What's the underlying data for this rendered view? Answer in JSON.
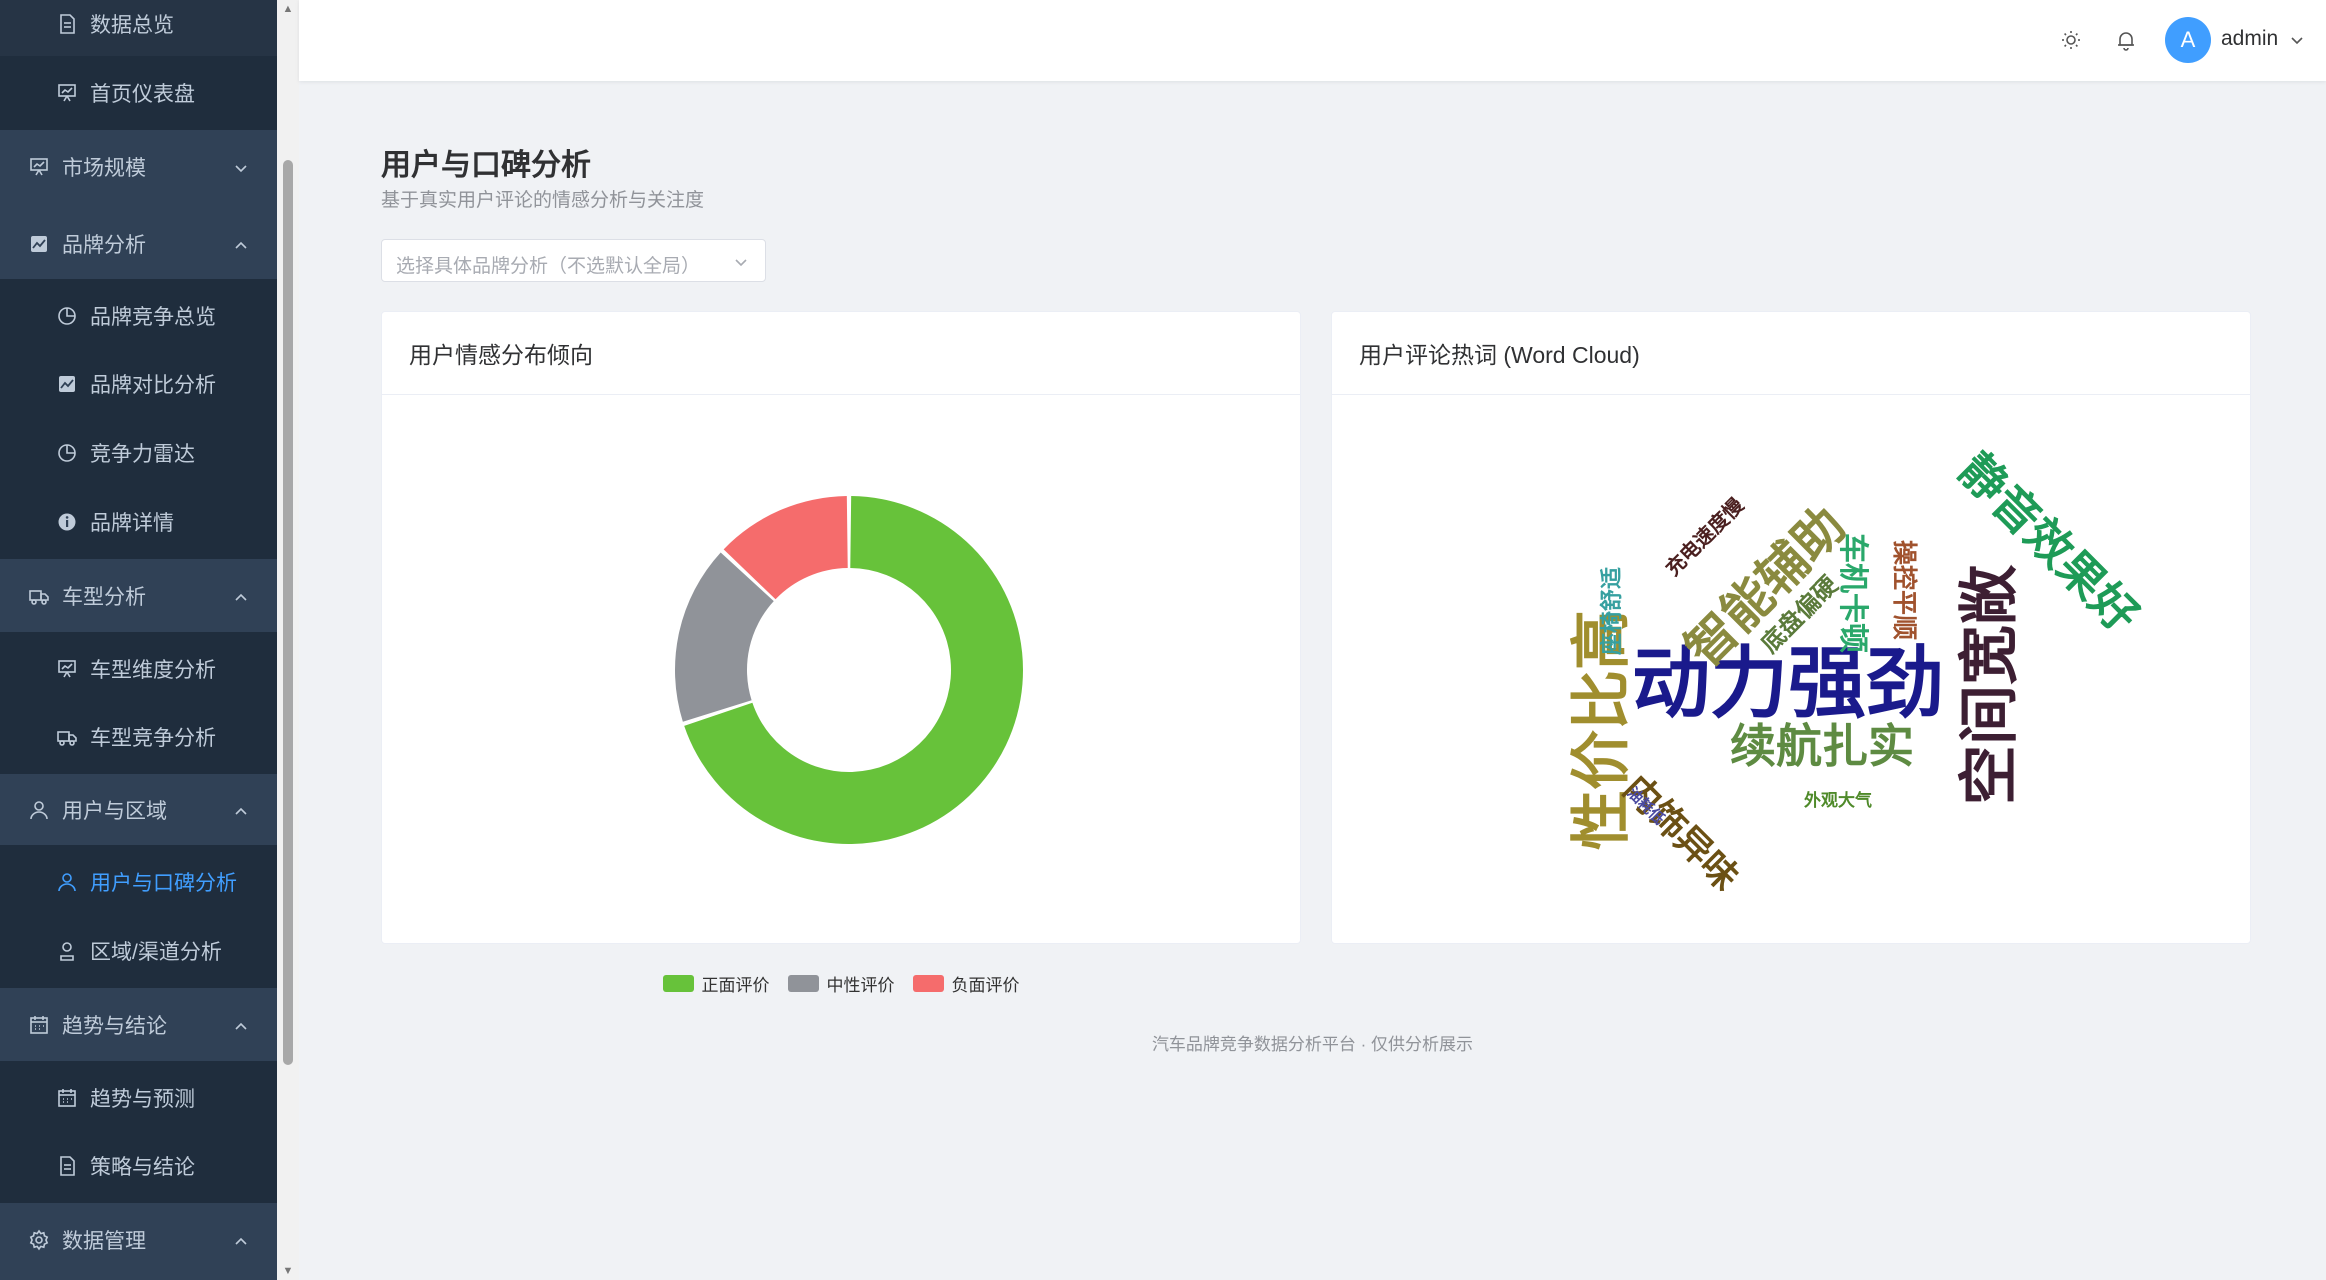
{
  "sidebar": {
    "items": [
      {
        "label": "数据总览",
        "icon": "document-icon",
        "type": "sub"
      },
      {
        "label": "首页仪表盘",
        "icon": "presentation-icon",
        "type": "sub"
      },
      {
        "label": "市场规模",
        "icon": "presentation-icon",
        "type": "top",
        "chevron": "down"
      },
      {
        "label": "品牌分析",
        "icon": "trend-chart-icon",
        "type": "top",
        "chevron": "up"
      },
      {
        "label": "品牌竞争总览",
        "icon": "pie-chart-icon",
        "type": "sub"
      },
      {
        "label": "品牌对比分析",
        "icon": "trend-chart-icon",
        "type": "sub"
      },
      {
        "label": "竞争力雷达",
        "icon": "pie-chart-icon",
        "type": "sub"
      },
      {
        "label": "品牌详情",
        "icon": "info-icon",
        "type": "sub"
      },
      {
        "label": "车型分析",
        "icon": "van-icon",
        "type": "top",
        "chevron": "up"
      },
      {
        "label": "车型维度分析",
        "icon": "presentation-icon",
        "type": "sub"
      },
      {
        "label": "车型竞争分析",
        "icon": "van-icon",
        "type": "sub"
      },
      {
        "label": "用户与区域",
        "icon": "user-icon",
        "type": "top",
        "chevron": "up"
      },
      {
        "label": "用户与口碑分析",
        "icon": "user-icon",
        "type": "sub",
        "active": true
      },
      {
        "label": "区域/渠道分析",
        "icon": "location-user-icon",
        "type": "sub"
      },
      {
        "label": "趋势与结论",
        "icon": "calendar-icon",
        "type": "top",
        "chevron": "up"
      },
      {
        "label": "趋势与预测",
        "icon": "calendar-icon",
        "type": "sub"
      },
      {
        "label": "策略与结论",
        "icon": "document-icon",
        "type": "sub"
      },
      {
        "label": "数据管理",
        "icon": "gear-icon",
        "type": "top",
        "chevron": "up"
      }
    ]
  },
  "header": {
    "theme_icon": "sun-icon",
    "bell_icon": "bell-icon",
    "avatar_letter": "A",
    "username": "admin"
  },
  "main": {
    "title": "用户与口碑分析",
    "subtitle": "基于真实用户评论的情感分析与关注度",
    "brand_select": {
      "placeholder": "选择具体品牌分析（不选默认全局）"
    },
    "sentiment_card": {
      "title": "用户情感分布倾向"
    },
    "wordcloud_card": {
      "title": "用户评论热词 (Word Cloud)"
    }
  },
  "chart_data": {
    "type": "pie",
    "variant": "donut",
    "categories": [
      "正面评价",
      "中性评价",
      "负面评价"
    ],
    "values": [
      70,
      17,
      13
    ],
    "colors": [
      "#67c23a",
      "#909399",
      "#f56c6c"
    ],
    "legend_position": "bottom"
  },
  "wordcloud": {
    "words": [
      {
        "text": "动力强劲",
        "color": "#1a1a8c"
      },
      {
        "text": "空间宽敞",
        "color": "#3d1f33"
      },
      {
        "text": "性价比高",
        "color": "#a08e2e"
      },
      {
        "text": "静音效果好",
        "color": "#1e9b57"
      },
      {
        "text": "智能辅助",
        "color": "#8a8a3f"
      },
      {
        "text": "续航扎实",
        "color": "#5e8b42"
      },
      {
        "text": "内饰异味",
        "color": "#6b5014"
      },
      {
        "text": "车机卡顿",
        "color": "#2aa86b"
      },
      {
        "text": "操控平顺",
        "color": "#a0522d"
      },
      {
        "text": "底盘偏硬",
        "color": "#5a7a3a"
      },
      {
        "text": "充电速度慢",
        "color": "#4a1f1f"
      },
      {
        "text": "座椅舒适",
        "color": "#36a0a0"
      },
      {
        "text": "外观大气",
        "color": "#4f8a2a"
      },
      {
        "text": "油耗低",
        "color": "#4a4aa0"
      }
    ]
  },
  "footer": {
    "text": "汽车品牌竞争数据分析平台 · 仅供分析展示"
  }
}
